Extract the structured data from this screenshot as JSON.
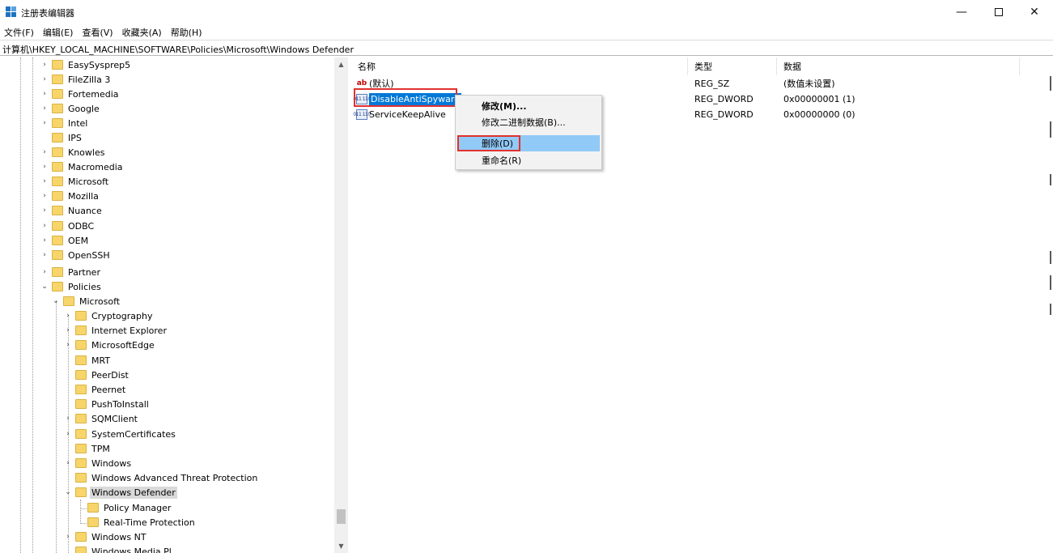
{
  "window": {
    "title": "注册表编辑器",
    "minimize_glyph": "—",
    "close_glyph": "✕",
    "icon": "registry-editor-icon"
  },
  "menu": [
    "文件(F)",
    "编辑(E)",
    "查看(V)",
    "收藏夹(A)",
    "帮助(H)"
  ],
  "address": "计算机\\HKEY_LOCAL_MACHINE\\SOFTWARE\\Policies\\Microsoft\\Windows Defender",
  "tree": {
    "items": [
      {
        "label": "EasySysprep5",
        "expander": "›"
      },
      {
        "label": "FileZilla 3",
        "expander": "›"
      },
      {
        "label": "Fortemedia",
        "expander": "›"
      },
      {
        "label": "Google",
        "expander": "›"
      },
      {
        "label": "Intel",
        "expander": "›"
      },
      {
        "label": "IPS",
        "expander": ""
      },
      {
        "label": "Knowles",
        "expander": "›"
      },
      {
        "label": "Macromedia",
        "expander": "›"
      },
      {
        "label": "Microsoft",
        "expander": "›"
      },
      {
        "label": "Mozilla",
        "expander": "›"
      },
      {
        "label": "Nuance",
        "expander": "›"
      },
      {
        "label": "ODBC",
        "expander": "›"
      },
      {
        "label": "OEM",
        "expander": "›"
      },
      {
        "label": "OpenSSH",
        "expander": "›"
      },
      {
        "label": "Partner",
        "expander": "›"
      },
      {
        "label": "Policies",
        "expander": "⌄"
      },
      {
        "label": "Microsoft",
        "expander": "⌄"
      },
      {
        "label": "Cryptography",
        "expander": "›"
      },
      {
        "label": "Internet Explorer",
        "expander": "›"
      },
      {
        "label": "MicrosoftEdge",
        "expander": "›"
      },
      {
        "label": "MRT",
        "expander": ""
      },
      {
        "label": "PeerDist",
        "expander": ""
      },
      {
        "label": "Peernet",
        "expander": ""
      },
      {
        "label": "PushToInstall",
        "expander": ""
      },
      {
        "label": "SQMClient",
        "expander": "›"
      },
      {
        "label": "SystemCertificates",
        "expander": "›"
      },
      {
        "label": "TPM",
        "expander": ""
      },
      {
        "label": "Windows",
        "expander": "›"
      },
      {
        "label": "Windows Advanced Threat Protection",
        "expander": ""
      },
      {
        "label": "Windows Defender",
        "expander": "⌄"
      },
      {
        "label": "Policy Manager",
        "expander": ""
      },
      {
        "label": "Real-Time Protection",
        "expander": ""
      },
      {
        "label": "Windows NT",
        "expander": "›"
      },
      {
        "label": "Windows Media Pl...",
        "expander": ""
      }
    ],
    "scroll_up": "▲",
    "scroll_down": "▼"
  },
  "list": {
    "headers": {
      "name": "名称",
      "type": "类型",
      "data": "数据"
    },
    "rows": [
      {
        "name": "(默认)",
        "type": "REG_SZ",
        "data": "(数值未设置)",
        "icon": "ab"
      },
      {
        "name": "DisableAntiSpyware",
        "type": "REG_DWORD",
        "data": "0x00000001 (1)",
        "icon": "011 110"
      },
      {
        "name": "ServiceKeepAlive",
        "type": "REG_DWORD",
        "data": "0x00000000 (0)",
        "icon": "011 110"
      }
    ]
  },
  "context_menu": {
    "modify": "修改(M)...",
    "modify_binary": "修改二进制数据(B)...",
    "delete": "删除(D)",
    "rename": "重命名(R)"
  },
  "colors": {
    "selection": "#0078d7",
    "highlight_frame": "#e0312f",
    "menu_hover": "#91c9f7",
    "folder": "#f7d56b"
  }
}
